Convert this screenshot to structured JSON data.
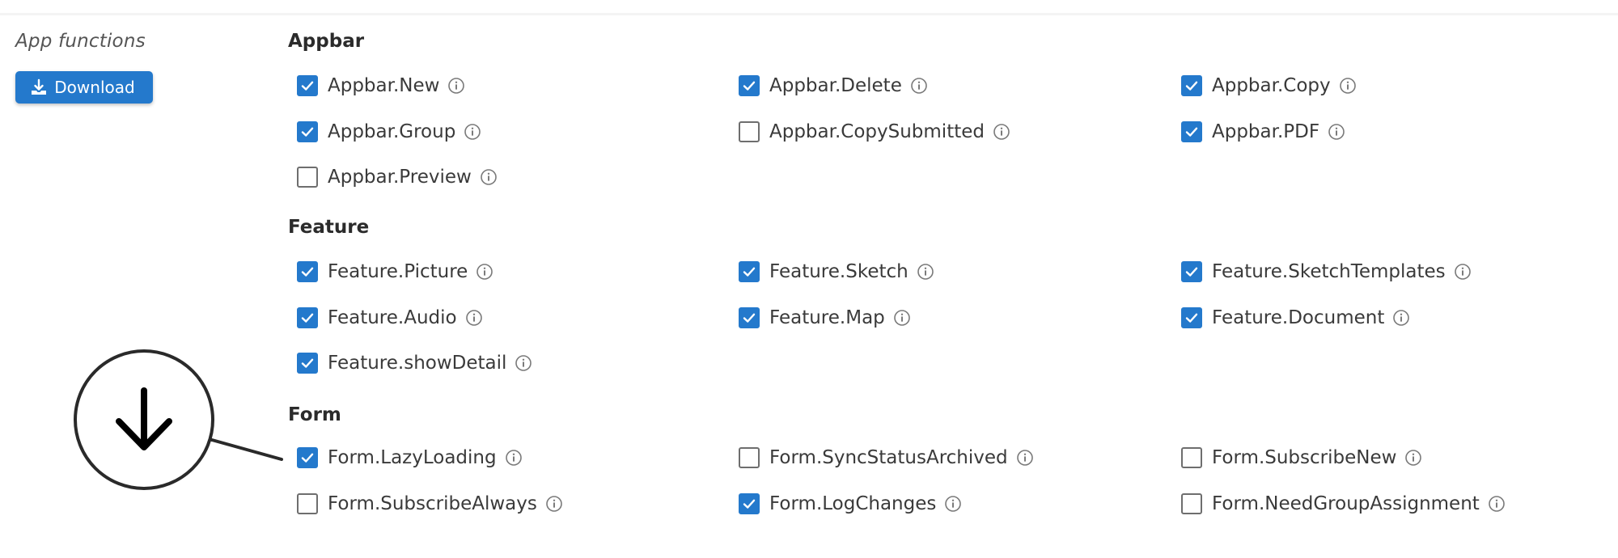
{
  "sidebar": {
    "label": "App functions",
    "download_button": {
      "label": "Download",
      "icon": "download-icon"
    }
  },
  "sections": [
    {
      "title": "Appbar",
      "options": [
        {
          "label": "Appbar.New",
          "checked": true
        },
        {
          "label": "Appbar.Delete",
          "checked": true
        },
        {
          "label": "Appbar.Copy",
          "checked": true
        },
        {
          "label": "Appbar.Group",
          "checked": true
        },
        {
          "label": "Appbar.CopySubmitted",
          "checked": false
        },
        {
          "label": "Appbar.PDF",
          "checked": true
        },
        {
          "label": "Appbar.Preview",
          "checked": false
        }
      ]
    },
    {
      "title": "Feature",
      "options": [
        {
          "label": "Feature.Picture",
          "checked": true
        },
        {
          "label": "Feature.Sketch",
          "checked": true
        },
        {
          "label": "Feature.SketchTemplates",
          "checked": true
        },
        {
          "label": "Feature.Audio",
          "checked": true
        },
        {
          "label": "Feature.Map",
          "checked": true
        },
        {
          "label": "Feature.Document",
          "checked": true
        },
        {
          "label": "Feature.showDetail",
          "checked": true
        }
      ]
    },
    {
      "title": "Form",
      "options": [
        {
          "label": "Form.LazyLoading",
          "checked": true
        },
        {
          "label": "Form.SyncStatusArchived",
          "checked": false
        },
        {
          "label": "Form.SubscribeNew",
          "checked": false
        },
        {
          "label": "Form.SubscribeAlways",
          "checked": false
        },
        {
          "label": "Form.LogChanges",
          "checked": true
        },
        {
          "label": "Form.NeedGroupAssignment",
          "checked": false
        }
      ]
    }
  ],
  "icons": {
    "info": "info-icon",
    "callout": "arrow-down-circle-icon"
  },
  "colors": {
    "accent": "#2479cc",
    "checkbox_border": "#6e6e6e",
    "text": "#3a3a3a"
  }
}
